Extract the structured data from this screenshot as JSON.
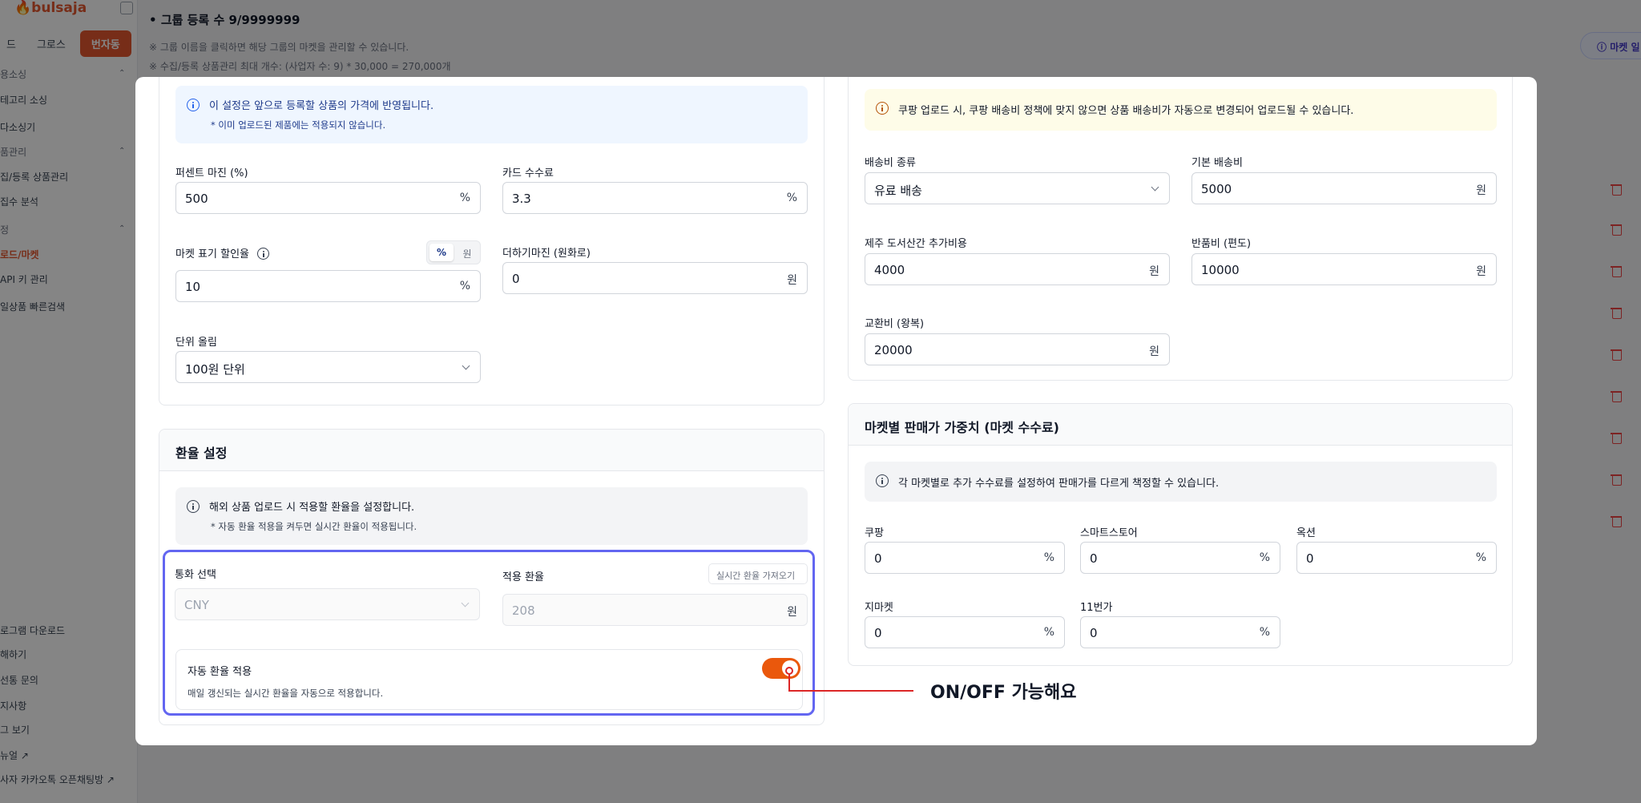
{
  "background": {
    "logo": "bulsaja",
    "sidebar_tabs": [
      "드",
      "그로스",
      "번자동"
    ],
    "sidebar_items": [
      "용소싱",
      "테고리 소싱",
      "다소싱기",
      "품관리",
      "집/등록 상품관리",
      "집수 분석",
      "정",
      "로드/마켓",
      "API 키 관리",
      "일상품 빠른검색",
      "로그램 다운로드",
      "해하기",
      "선통 문의",
      "지사항",
      "그 보기",
      "뉴얼 ↗",
      "사자 카카오톡 오픈채팅방 ↗"
    ],
    "group_count": "그룹 등록 수 9/9999999",
    "info_line_1": "※ 그룹 이름을 클릭하면 해당 그룹의 마켓을 관리할 수 있습니다.",
    "info_line_2": "※ 수집/등록 상품관리 최대 개수: (사업자 수: 9) * 30,000 = 270,000개",
    "market_button": "마켓 일"
  },
  "pricing": {
    "notice_title": "이 설정은 앞으로 등록할 상품의 가격에 반영됩니다.",
    "notice_sub": "* 이미 업로드된 제품에는 적용되지 않습니다.",
    "percent_margin": {
      "label": "퍼센트 마진 (%)",
      "value": "500",
      "unit": "%"
    },
    "card_fee": {
      "label": "카드 수수료",
      "value": "3.3",
      "unit": "%"
    },
    "market_discount": {
      "label": "마켓 표기 할인율",
      "value": "10",
      "unit": "%",
      "toggle_percent": "%",
      "toggle_won": "원"
    },
    "extra_margin": {
      "label": "더하기마진 (원화로)",
      "value": "0",
      "unit": "원"
    },
    "rounding": {
      "label": "단위 올림",
      "value": "100원 단위"
    }
  },
  "exchange": {
    "title": "환율 설정",
    "notice_title": "해외 상품 업로드 시 적용할 환율을 설정합니다.",
    "notice_sub": "* 자동 환율 적용을 켜두면 실시간 환율이 적용됩니다.",
    "currency": {
      "label": "통화 선택",
      "value": "CNY"
    },
    "rate": {
      "label": "적용 환율",
      "value": "208",
      "unit": "원",
      "fetch_button": "실시간 환율 가져오기"
    },
    "auto": {
      "label": "자동 환율 적용",
      "desc": "매일 갱신되는 실시간 환율을 자동으로 적용합니다.",
      "enabled": true
    }
  },
  "shipping": {
    "notice": "쿠팡 업로드 시, 쿠팡 배송비 정책에 맞지 않으면 상품 배송비가 자동으로 변경되어 업로드될 수 있습니다.",
    "type": {
      "label": "배송비 종류",
      "value": "유료 배송"
    },
    "base_fee": {
      "label": "기본 배송비",
      "value": "5000",
      "unit": "원"
    },
    "jeju_fee": {
      "label": "제주 도서산간 추가비용",
      "value": "4000",
      "unit": "원"
    },
    "return_fee": {
      "label": "반품비 (편도)",
      "value": "10000",
      "unit": "원"
    },
    "exchange_fee": {
      "label": "교환비 (왕복)",
      "value": "20000",
      "unit": "원"
    }
  },
  "market_weights": {
    "title": "마켓별 판매가 가중치 (마켓 수수료)",
    "notice": "각 마켓별로 추가 수수료를 설정하여 판매가를 다르게 책정할 수 있습니다.",
    "coupang": {
      "label": "쿠팡",
      "value": "0",
      "unit": "%"
    },
    "smartstore": {
      "label": "스마트스토어",
      "value": "0",
      "unit": "%"
    },
    "auction": {
      "label": "옥션",
      "value": "0",
      "unit": "%"
    },
    "gmarket": {
      "label": "지마켓",
      "value": "0",
      "unit": "%"
    },
    "st11": {
      "label": "11번가",
      "value": "0",
      "unit": "%"
    }
  },
  "annotation": {
    "text": "ON/OFF 가능해요"
  },
  "colors": {
    "accent": "#e4572e",
    "toggle_on": "#ea580c",
    "highlight": "#6366f1",
    "annotation": "#dc2626"
  }
}
